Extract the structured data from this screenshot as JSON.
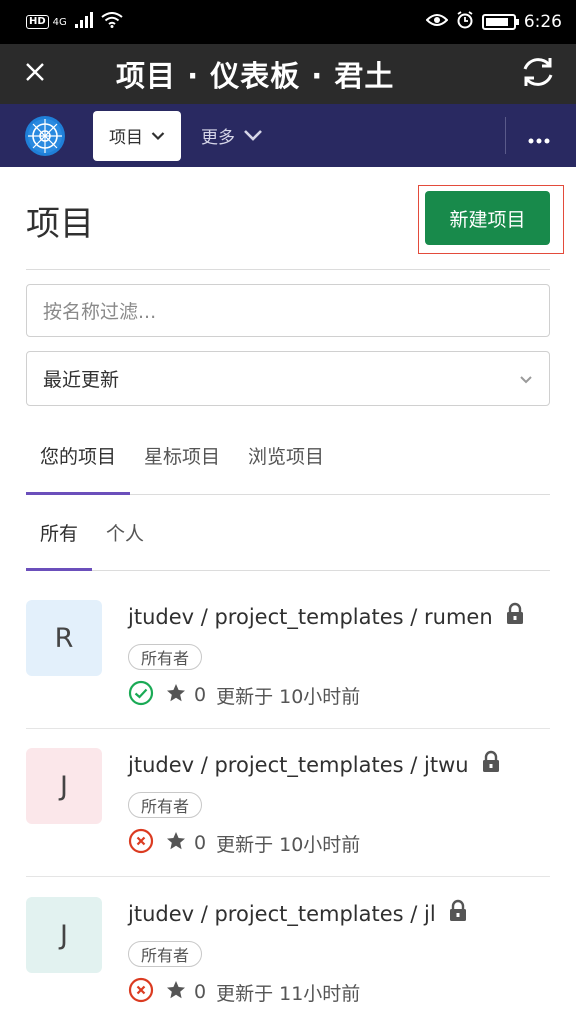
{
  "status_bar": {
    "hd": "HD",
    "signal": "4G",
    "time": "6:26",
    "battery_level": 0.85
  },
  "title_bar": {
    "title": "项目 · 仪表板 · 君土"
  },
  "nav": {
    "projects_label": "项目",
    "more_label": "更多"
  },
  "header": {
    "title": "项目",
    "new_project_label": "新建项目"
  },
  "filter": {
    "placeholder": "按名称过滤..."
  },
  "sort": {
    "selected": "最近更新"
  },
  "tabs": [
    {
      "label": "您的项目",
      "active": true
    },
    {
      "label": "星标项目",
      "active": false
    },
    {
      "label": "浏览项目",
      "active": false
    }
  ],
  "subtabs": [
    {
      "label": "所有",
      "active": true
    },
    {
      "label": "个人",
      "active": false
    }
  ],
  "projects": [
    {
      "avatar_letter": "R",
      "avatar_color": "#e3f0fb",
      "title": "jtudev / project_templates / rumen",
      "role": "所有者",
      "pipeline": "success",
      "stars": "0",
      "updated": "更新于 10小时前"
    },
    {
      "avatar_letter": "J",
      "avatar_color": "#fbe7ea",
      "title": "jtudev / project_templates / jtwu",
      "role": "所有者",
      "pipeline": "failed",
      "stars": "0",
      "updated": "更新于 10小时前"
    },
    {
      "avatar_letter": "J",
      "avatar_color": "#e2f2f0",
      "title": "jtudev / project_templates / jl",
      "role": "所有者",
      "pipeline": "failed",
      "stars": "0",
      "updated": "更新于 11小时前"
    }
  ],
  "colors": {
    "nav_bg": "#292961",
    "accent_tab": "#6b4fbb",
    "new_button": "#188a4b",
    "success": "#1aaa55",
    "failed": "#db3b21"
  }
}
